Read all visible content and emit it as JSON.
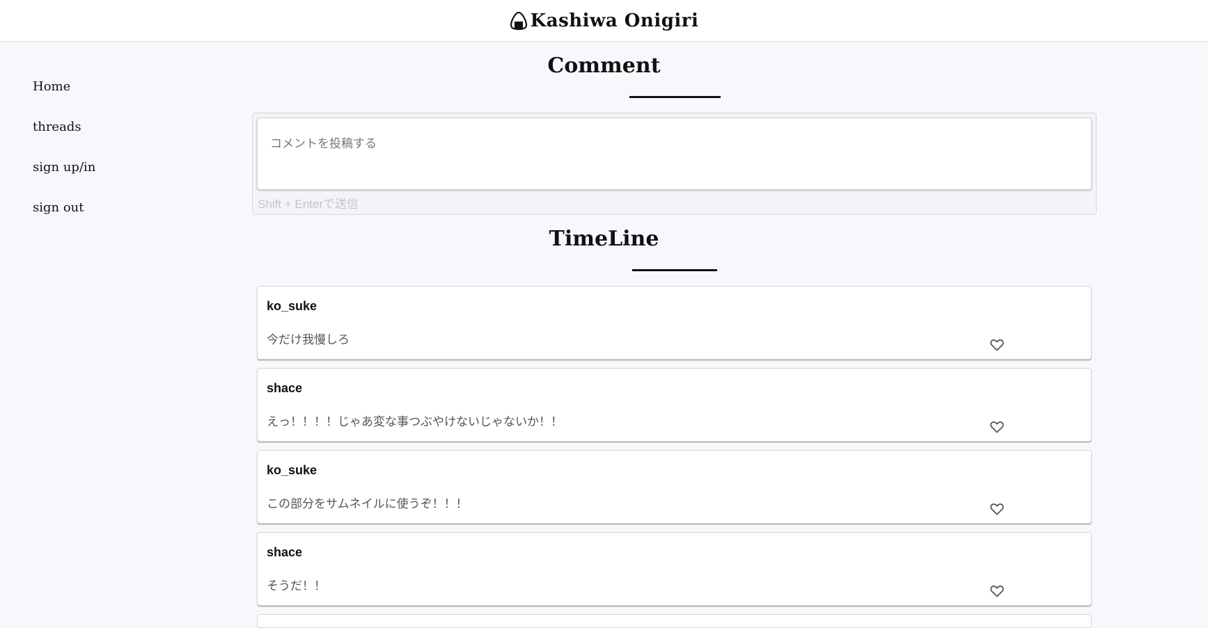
{
  "header": {
    "brand": "Kashiwa Onigiri",
    "logo_icon": "onigiri-icon"
  },
  "sidebar": {
    "items": [
      {
        "label": "Home"
      },
      {
        "label": "threads"
      },
      {
        "label": "sign up/in"
      },
      {
        "label": "sign out"
      }
    ]
  },
  "comment": {
    "title": "Comment",
    "placeholder": "コメントを投稿する",
    "hint": "Shift + Enterで送信"
  },
  "timeline": {
    "title": "TimeLine",
    "posts": [
      {
        "user": "ko_suke",
        "text": "今だけ我慢しろ",
        "like_icon": "heart-icon"
      },
      {
        "user": "shace",
        "text": "えっ！！！！じゃあ変な事つぶやけないじゃないか！！",
        "like_icon": "heart-icon"
      },
      {
        "user": "ko_suke",
        "text": "この部分をサムネイルに使うぞ！！！",
        "like_icon": "heart-icon"
      },
      {
        "user": "shace",
        "text": "そうだ！！",
        "like_icon": "heart-icon"
      }
    ]
  }
}
